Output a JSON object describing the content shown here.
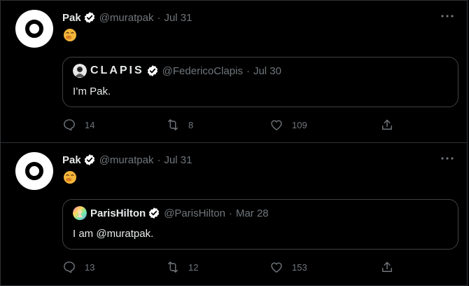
{
  "tweets": [
    {
      "author_name": "Pak",
      "author_handle": "@muratpak",
      "separator": "·",
      "date": "Jul 31",
      "emoji": "face-with-hand-over-mouth",
      "quote": {
        "name": "CLAPIS",
        "handle": "@FedericoClapis",
        "separator": "·",
        "date": "Jul 30",
        "text": "I’m Pak."
      },
      "actions": {
        "replies": "14",
        "retweets": "8",
        "likes": "109"
      }
    },
    {
      "author_name": "Pak",
      "author_handle": "@muratpak",
      "separator": "·",
      "date": "Jul 31",
      "emoji": "face-with-hand-over-mouth",
      "quote": {
        "name": "ParisHilton",
        "handle": "@ParisHilton",
        "separator": "·",
        "date": "Mar 28",
        "text": "I am @muratpak."
      },
      "actions": {
        "replies": "13",
        "retweets": "12",
        "likes": "153"
      }
    }
  ],
  "icons": {
    "more": "more-icon",
    "verified": "verified-badge-icon",
    "reply": "reply-icon",
    "retweet": "retweet-icon",
    "like": "like-icon",
    "share": "share-icon"
  },
  "colors": {
    "background": "#000000",
    "text": "#e7e9ea",
    "muted": "#71767b",
    "border": "#2f3336",
    "verified": "#ffffff"
  }
}
